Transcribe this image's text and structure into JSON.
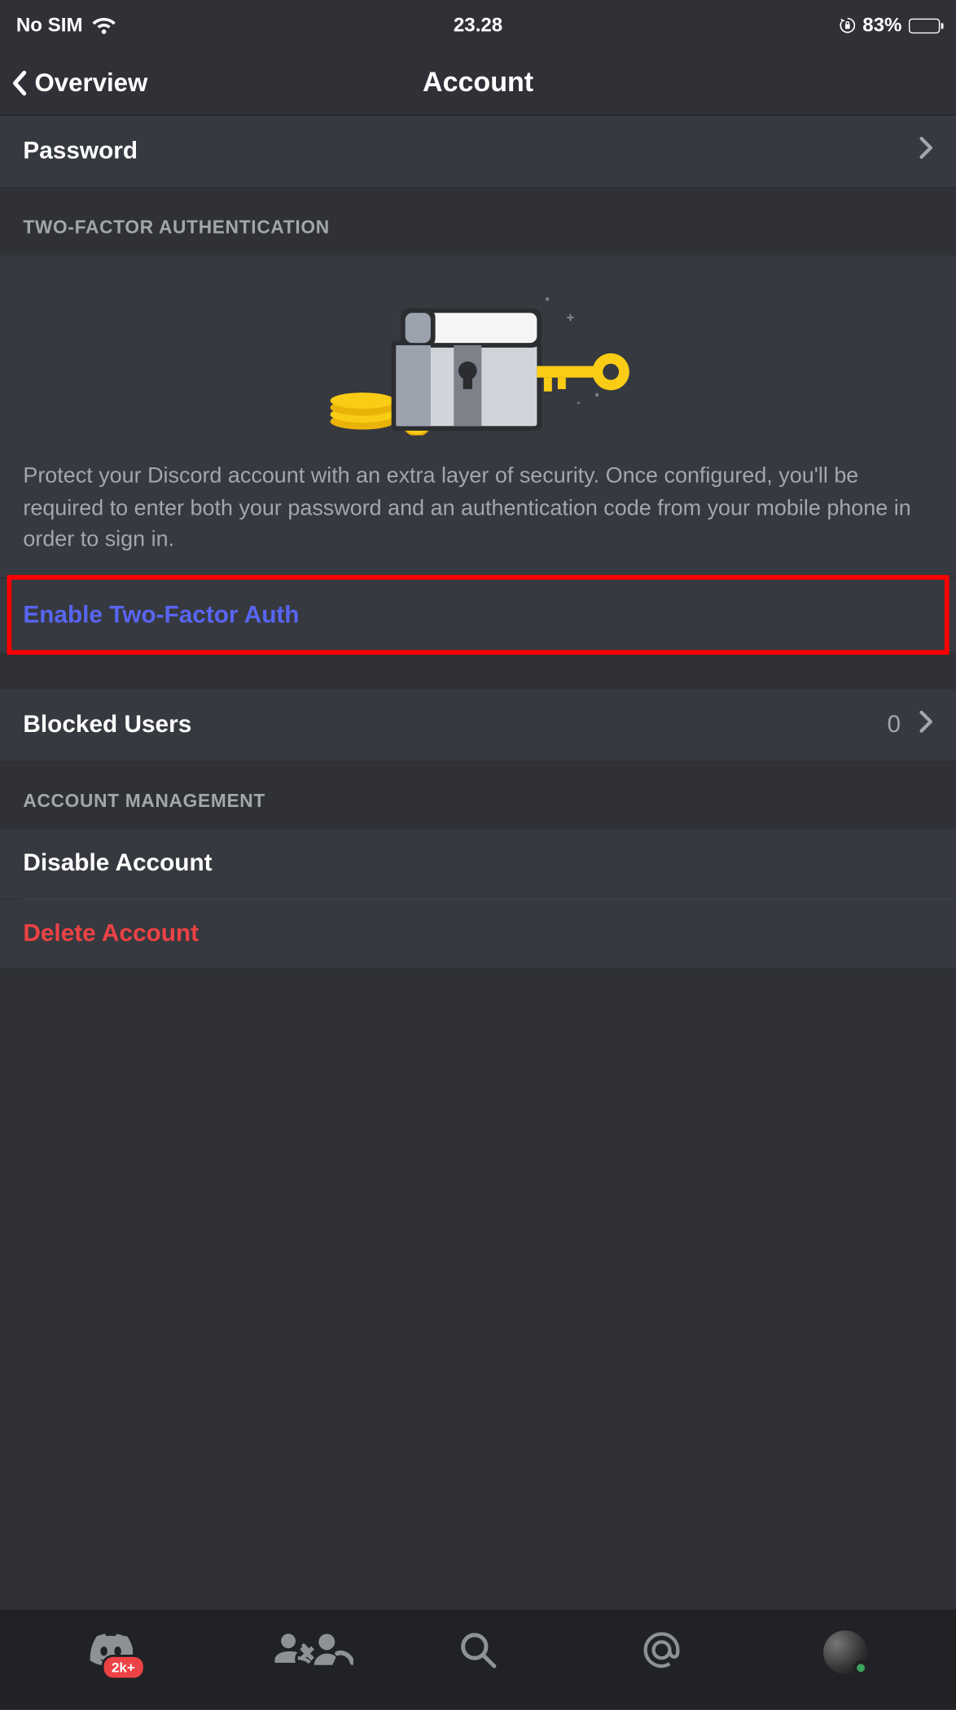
{
  "status_bar": {
    "carrier": "No SIM",
    "time": "23.28",
    "battery_pct": "83%"
  },
  "header": {
    "back_label": "Overview",
    "title": "Account"
  },
  "rows": {
    "password_label": "Password",
    "blocked_users_label": "Blocked Users",
    "blocked_users_count": "0",
    "disable_account_label": "Disable Account",
    "delete_account_label": "Delete Account"
  },
  "sections": {
    "twofa_header": "TWO-FACTOR AUTHENTICATION",
    "twofa_desc": "Protect your Discord account with an extra layer of security. Once configured, you'll be required to enter both your password and an authentication code from your mobile phone in order to sign in.",
    "enable_twofa_label": "Enable Two-Factor Auth",
    "account_mgmt_header": "ACCOUNT MANAGEMENT"
  },
  "tab_bar": {
    "badge": "2k+"
  }
}
